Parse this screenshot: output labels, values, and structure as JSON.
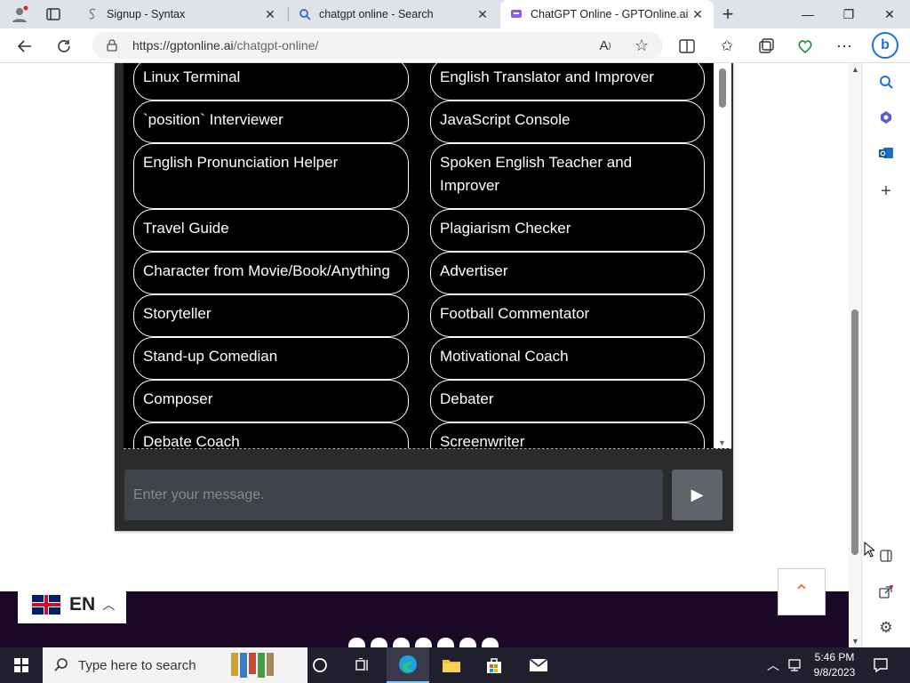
{
  "browser": {
    "tabs": [
      {
        "title": "Signup - Syntax",
        "icon": "syntax-icon"
      },
      {
        "title": "chatgpt online - Search",
        "icon": "search-icon"
      },
      {
        "title": "ChatGPT Online - GPTOnline.ai",
        "icon": "gptonline-icon"
      }
    ],
    "active_tab_index": 2,
    "url_host": "https://gptonline.ai",
    "url_path": "/chatgpt-online/"
  },
  "prompts": {
    "left": [
      "Linux Terminal",
      "`position` Interviewer",
      "English Pronunciation Helper",
      "Travel Guide",
      "Character from Movie/Book/Anything",
      "Storyteller",
      "Stand-up Comedian",
      "Composer",
      "Debate Coach"
    ],
    "right": [
      "English Translator and Improver",
      "JavaScript Console",
      "Spoken English Teacher and Improver",
      "Plagiarism Checker",
      "Advertiser",
      "Football Commentator",
      "Motivational Coach",
      "Debater",
      "Screenwriter"
    ]
  },
  "chat": {
    "placeholder": "Enter your message."
  },
  "language": {
    "code": "EN"
  },
  "taskbar": {
    "search_label": "Type here to search",
    "time": "5:46 PM",
    "date": "9/8/2023"
  },
  "colors": {
    "accent": "#e07a3a",
    "footer": "#1a0826",
    "panel": "#2b2b2b",
    "input": "#3f434a"
  }
}
